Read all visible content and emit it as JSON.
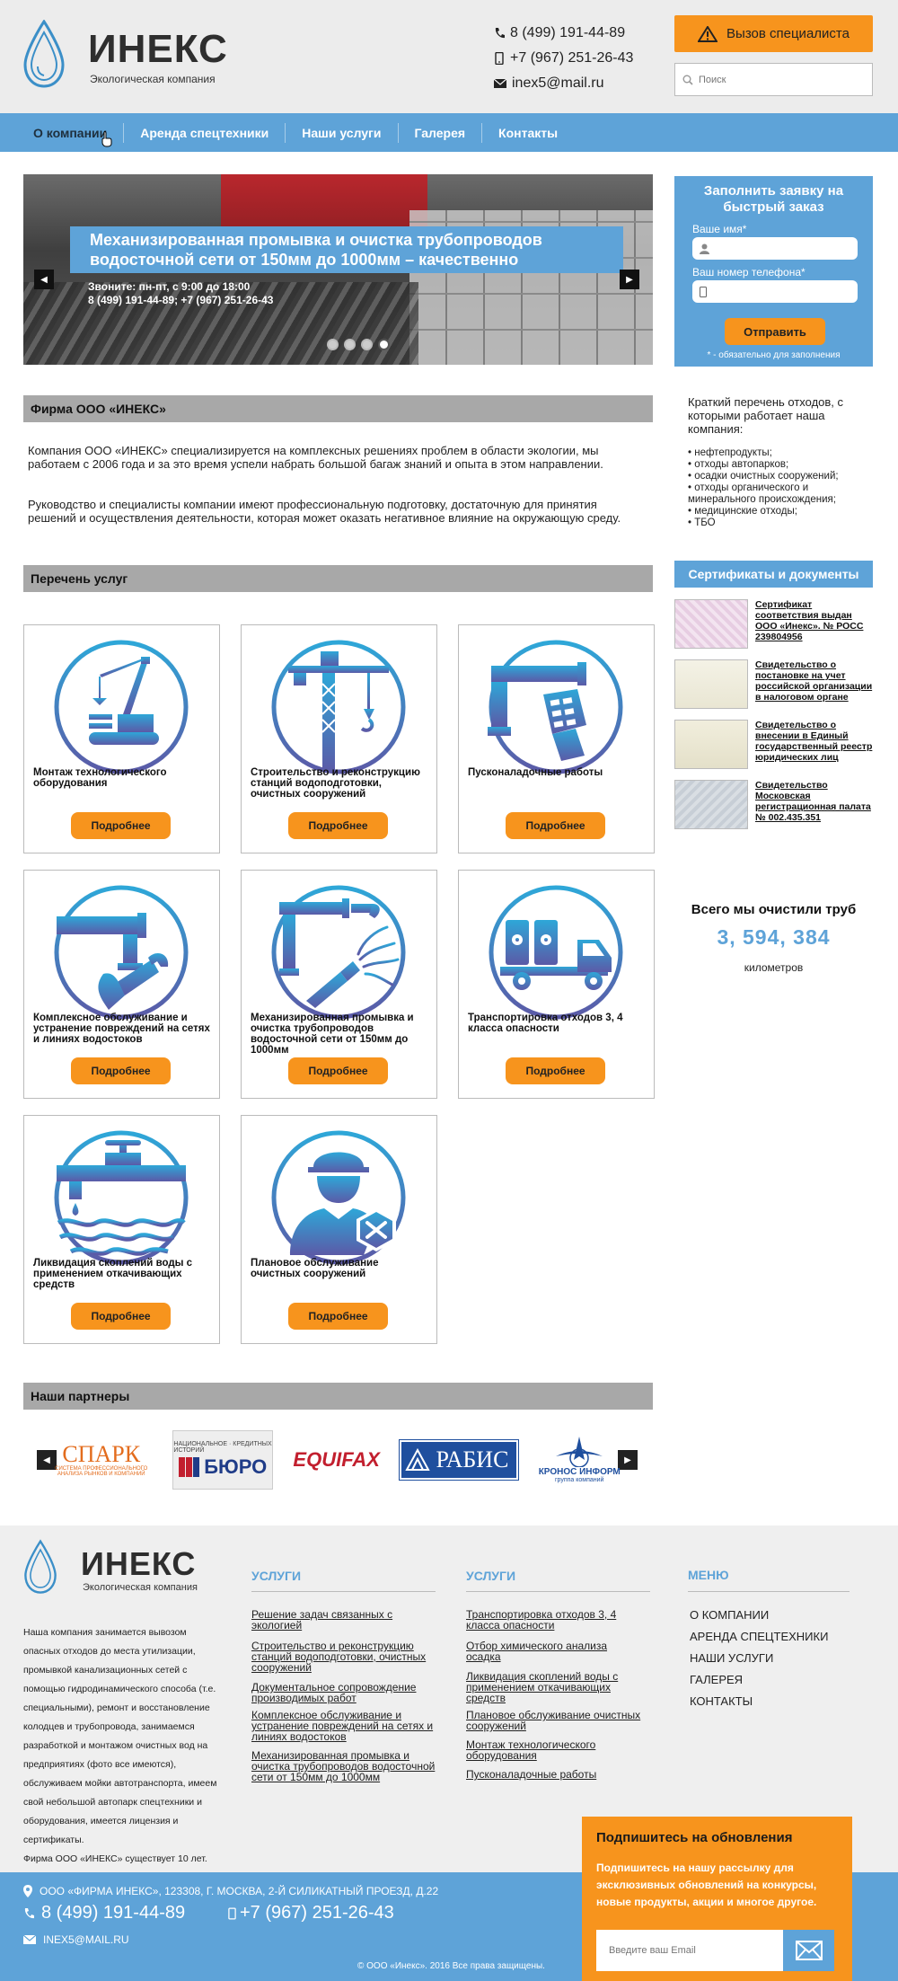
{
  "header": {
    "logo_title": "ИНЕКС",
    "logo_subtitle": "Экологическая компания",
    "phone1": "8 (499) 191-44-89",
    "phone2": "+7 (967) 251-26-43",
    "email": "inex5@mail.ru",
    "call_button": "Вызов специалиста",
    "search_placeholder": "Поиск"
  },
  "nav": {
    "items": [
      "О компании",
      "Аренда спецтехники",
      "Наши услуги",
      "Галерея",
      "Контакты"
    ],
    "active": "О компании"
  },
  "slider": {
    "caption": "Механизированная промывка и очистка  трубопроводов водосточной сети от 150мм до 1000мм – качественно",
    "sub1": "Звоните: пн-пт, с 9:00 до 18:00",
    "sub2": "8 (499) 191-44-89; +7 (967) 251-26-43",
    "dots": 4,
    "active_dot": 4
  },
  "request": {
    "title": "Заполнить заявку на быстрый заказ",
    "name_label": "Ваше имя*",
    "phone_label": "Ваш номер телефона*",
    "submit": "Отправить",
    "note": "* - обязательно для заполнения"
  },
  "company": {
    "heading": "Фирма ООО «ИНЕКС»",
    "p1": "Компания ООО «ИНЕКС»  специализируется  на  комплексных решениях  проблем в области экологии, мы работаем с 2006 года и за это время успели набрать большой багаж знаний и опыта в этом направлении.",
    "p2": "Руководство и специалисты компании имеют профессиональную подготовку, достаточную для принятия решений и осуществления деятельности, которая может оказать негативное влияние на окружающую среду."
  },
  "waste": {
    "intro": "Краткий перечень отходов, с которыми работает наша компания:",
    "items": [
      "• нефтепродукты;",
      "• отходы автопарков;",
      "• осадки очистных сооружений;",
      "• отходы органического и минерального происхождения;",
      "• медицинские отходы;",
      "• ТБО"
    ]
  },
  "certs": {
    "heading": "Сертификаты и документы",
    "items": [
      "Сертификат соответствия выдан ООО «Инекс». № РОСС 239804956",
      "Свидетельство о постановке на учет российской организации в налоговом органе",
      "Свидетельство о внесении в Единый государственный реестр юридических лиц",
      "Свидетельство Московская регистрационная палата № 002.435.351"
    ]
  },
  "cleaned": {
    "title": "Всего мы очистили труб",
    "value": "3, 594, 384",
    "unit": "километров"
  },
  "services": {
    "heading": "Перечень услуг",
    "more_label": "Подробнее",
    "items": [
      {
        "title": "Монтаж технологического оборудования",
        "icon": "crane-icon"
      },
      {
        "title": "Строительство и реконструкцию станций водоподготовки, очистных сооружений",
        "icon": "tower-crane-icon"
      },
      {
        "title": "Пусконаладочные работы",
        "icon": "pipe-controller-icon"
      },
      {
        "title": "Комплексное  обслуживание и устранение повреждений на сетях и линиях водостоков",
        "icon": "pipe-wrench-icon"
      },
      {
        "title": "Механизированная промывка и очистка  трубопроводов водосточной сети от 150мм до 1000мм",
        "icon": "pipe-washing-icon"
      },
      {
        "title": "Транспортировка  отходов 3, 4 класса опасности",
        "icon": "hazmat-truck-icon"
      },
      {
        "title": "Ликвидация скоплений воды с применением откачивающих средств",
        "icon": "water-pump-icon"
      },
      {
        "title": "Плановое обслуживание очистных сооружений",
        "icon": "worker-icon"
      }
    ]
  },
  "partners": {
    "heading": "Наши партнеры",
    "items": [
      "СПАРК",
      "БЮРО",
      "EQUIFAX",
      "РАБИС",
      "КРОНОС ИНФОРМ"
    ],
    "sub_spark": "СИСТЕМА ПРОФЕССИОНАЛЬНОГО АНАЛИЗА РЫНКОВ И КОМПАНИЙ",
    "sub_buro": "НАЦИОНАЛЬНОЕ · КРЕДИТНЫХ ИСТОРИЙ",
    "sub_kronos": "группа компаний"
  },
  "footer": {
    "about": "Наша компания занимается вывозом опасных отходов до места утилизации, промывкой канализационных сетей с помощью гидродинамического способа (т.е. специальными), ремонт и восстановление колодцев и трубопровода, занимаемся разработкой и монтажом очистных вод на предприятиях (фото все имеются), обслуживаем мойки автотранспорта, имеем свой небольшой автопарк спецтехники и оборудования, имеется лицензия и сертификаты.",
    "about2": "Фирма ООО «ИНЕКС» существует 10 лет.",
    "col1_title": "УСЛУГИ",
    "col1": [
      "Решение задач связанных с экологией",
      "Строительство и реконструкцию станций водоподготовки, очистных сооружений",
      "Документальное сопровождение производимых работ",
      "Комплексное  обслуживание  и устранение повреждений на сетях и линиях водостоков",
      "Механизированная промывка и очистка  трубопроводов водосточной сети от 150мм до 1000мм"
    ],
    "col2_title": "УСЛУГИ",
    "col2": [
      "Транспортировка  отходов  3, 4 класса опасности",
      "Отбор  химического  анализа осадка",
      "Ликвидация скоплений воды с применением откачивающих средств",
      "Плановое обслуживание очистных сооружений",
      "Монтаж технологического оборудования",
      "Пусконаладочные работы"
    ],
    "col3_title": "МЕНЮ",
    "col3": [
      "О КОМПАНИИ",
      "АРЕНДА СПЕЦТЕХНИКИ",
      "НАШИ УСЛУГИ",
      "ГАЛЕРЕЯ",
      "КОНТАКТЫ"
    ],
    "address": "ООО «ФИРМА ИНЕКС», 123308, Г. МОСКВА, 2-Й СИЛИКАТНЫЙ ПРОЕЗД, Д.22",
    "phone1": "8 (499) 191-44-89",
    "phone2": "+7 (967) 251-26-43",
    "email": "INEX5@MAIL.RU",
    "copyright": "© ООО «Инекс». 2016 Все права защищены."
  },
  "subscribe": {
    "title": "Подпишитесь на обновления",
    "text": "Подпишитесь на нашу рассылку для эксклюзивных обновлений на конкурсы, новые продукты, акции и многое другое.",
    "placeholder": "Введите ваш Email"
  },
  "colors": {
    "accent_blue": "#5ea3d8",
    "accent_orange": "#f7941d",
    "bar_gray": "#a8a8a8"
  }
}
